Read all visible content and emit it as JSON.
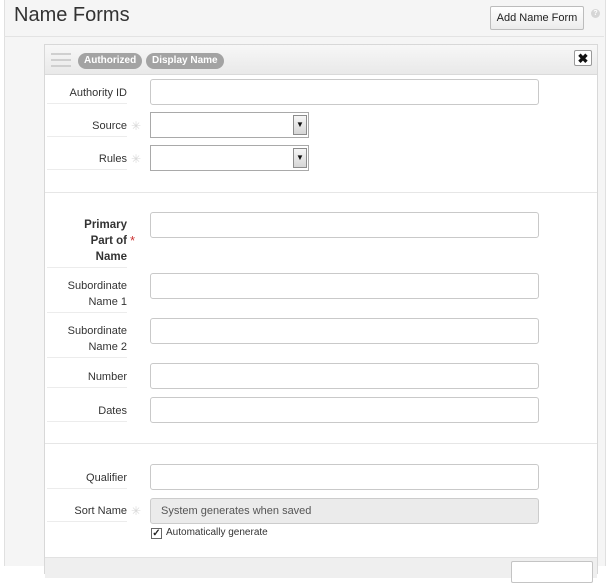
{
  "page": {
    "title": "Name Forms"
  },
  "toolbar": {
    "add_label": "Add Name Form",
    "help_icon": "?"
  },
  "card": {
    "badges": [
      "Authorized",
      "Display Name"
    ],
    "close_label": "✖"
  },
  "fields": {
    "authority_id": {
      "label": "Authority ID",
      "value": ""
    },
    "source": {
      "label": "Source",
      "value": ""
    },
    "rules": {
      "label": "Rules",
      "value": ""
    },
    "primary": {
      "label": [
        "Primary",
        "Part of",
        "Name"
      ],
      "value": ""
    },
    "sub1": {
      "label": [
        "Subordinate",
        "Name 1"
      ],
      "value": ""
    },
    "sub2": {
      "label": [
        "Subordinate",
        "Name 2"
      ],
      "value": ""
    },
    "number": {
      "label": "Number",
      "value": ""
    },
    "dates": {
      "label": "Dates",
      "value": ""
    },
    "qualifier": {
      "label": "Qualifier",
      "value": ""
    },
    "sort_name": {
      "label": "Sort Name",
      "value": "System generates when saved"
    }
  },
  "auto_generate": {
    "label": "Automatically generate",
    "checked": true,
    "check_glyph": "✓"
  },
  "marks": {
    "required": "*",
    "optional": "✳"
  },
  "dropdown_arrow": "▼"
}
